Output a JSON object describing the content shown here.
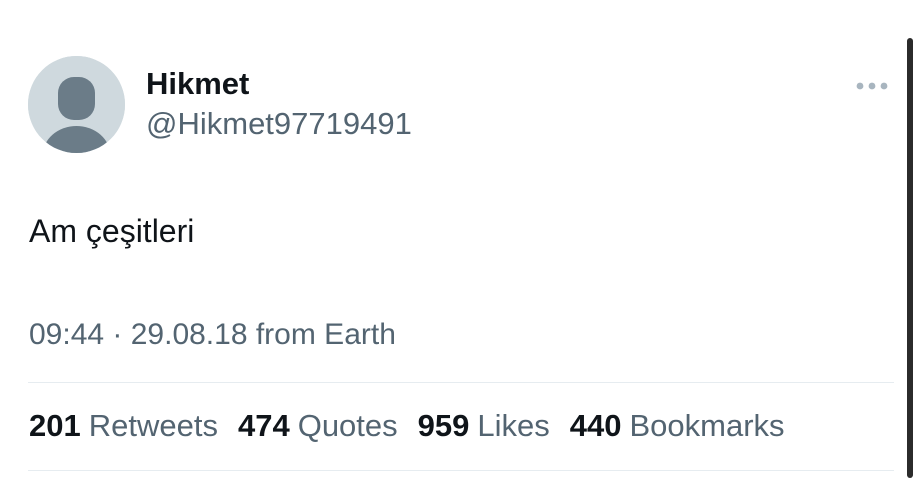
{
  "tweet": {
    "author": {
      "display_name": "Hikmet",
      "handle": "@Hikmet97719491",
      "avatar_icon": "default-profile-icon"
    },
    "more_icon": "more-horizontal-icon",
    "text": "Am çeşitleri",
    "meta": "09:44 · 29.08.18 from Earth",
    "stats": [
      {
        "count": "201",
        "label": "Retweets"
      },
      {
        "count": "474",
        "label": "Quotes"
      },
      {
        "count": "959",
        "label": "Likes"
      },
      {
        "count": "440",
        "label": "Bookmarks"
      }
    ]
  },
  "colors": {
    "text_primary": "#0f1419",
    "text_secondary": "#536471",
    "avatar_bg": "#cfd9de",
    "avatar_fg": "#6b7c88",
    "divider": "#e6ecf0"
  }
}
